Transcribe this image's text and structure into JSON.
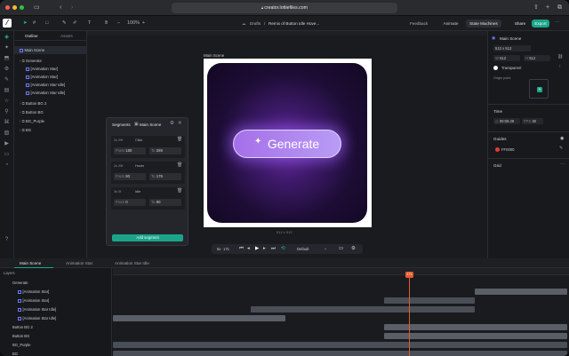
{
  "browser": {
    "url": "creator.lottiefiles.com"
  },
  "toolbar": {
    "zoom": "100%",
    "breadcrumb_root": "Drafts",
    "breadcrumb_sep": "/",
    "file_title": "Remix of Button Idle Hove...",
    "feedback": "Feedback",
    "mode_animate": "Animate",
    "mode_state": "State Machines",
    "share": "Share",
    "export": "Export"
  },
  "left_panel": {
    "tab_outline": "Outline",
    "tab_assets": "Assets",
    "items": [
      {
        "label": "Main Scene"
      },
      {
        "label": "Generate"
      },
      {
        "label": "[Animation Star]"
      },
      {
        "label": "[Animation Star]"
      },
      {
        "label": "[Animation Star Idle]"
      },
      {
        "label": "[Animation Star Idle]"
      },
      {
        "label": "Button BG 2"
      },
      {
        "label": "Button BG"
      },
      {
        "label": "BG_Purple"
      },
      {
        "label": "BG"
      }
    ]
  },
  "canvas": {
    "scene_label": "Main Scene",
    "button_text": "Generate",
    "size_label": "512 x 512"
  },
  "segments": {
    "title": "Segments",
    "scene": "Main Scene",
    "add_label": "Add segment",
    "from_label": "From",
    "to_label": "To",
    "items": [
      {
        "duration": "2s 29f",
        "name": "Click",
        "from": "180",
        "to": "269"
      },
      {
        "duration": "2s 29f",
        "name": "Hover",
        "from": "90",
        "to": "179"
      },
      {
        "duration": "3s 0f",
        "name": "Idle",
        "from": "0",
        "to": "90"
      }
    ]
  },
  "playback": {
    "speed": "6x",
    "frame": "171",
    "preset": "Default"
  },
  "right_panel": {
    "scene_title": "Main Scene",
    "size_preset": "512 x 512",
    "w_label": "W",
    "w": "512",
    "h_label": "H",
    "h": "512",
    "background": "Transparent",
    "origin_label": "Origin point",
    "time_title": "Time",
    "time_value": "00:09.29",
    "fps_label": "FPS",
    "fps": "30",
    "guides_title": "Guides",
    "guide_color": "FF0000",
    "grid_title": "Grid"
  },
  "timeline": {
    "tabs": [
      "Main Scene",
      "Animation Star",
      "Animation Star Idle"
    ],
    "layers_header": "Layers",
    "layers": [
      {
        "label": "Generate"
      },
      {
        "label": "[Animation Star]"
      },
      {
        "label": "[Animation Star]"
      },
      {
        "label": "[Animation Star Idle]"
      },
      {
        "label": "[Animation Star Idle]"
      },
      {
        "label": "Button BG 2"
      },
      {
        "label": "Button BG"
      },
      {
        "label": "BG_Purple"
      },
      {
        "label": "BG"
      }
    ],
    "playhead_frame": "171"
  },
  "colors": {
    "accent": "#1aa58a",
    "playhead": "#e35a2e",
    "button": "#a56fe8"
  }
}
